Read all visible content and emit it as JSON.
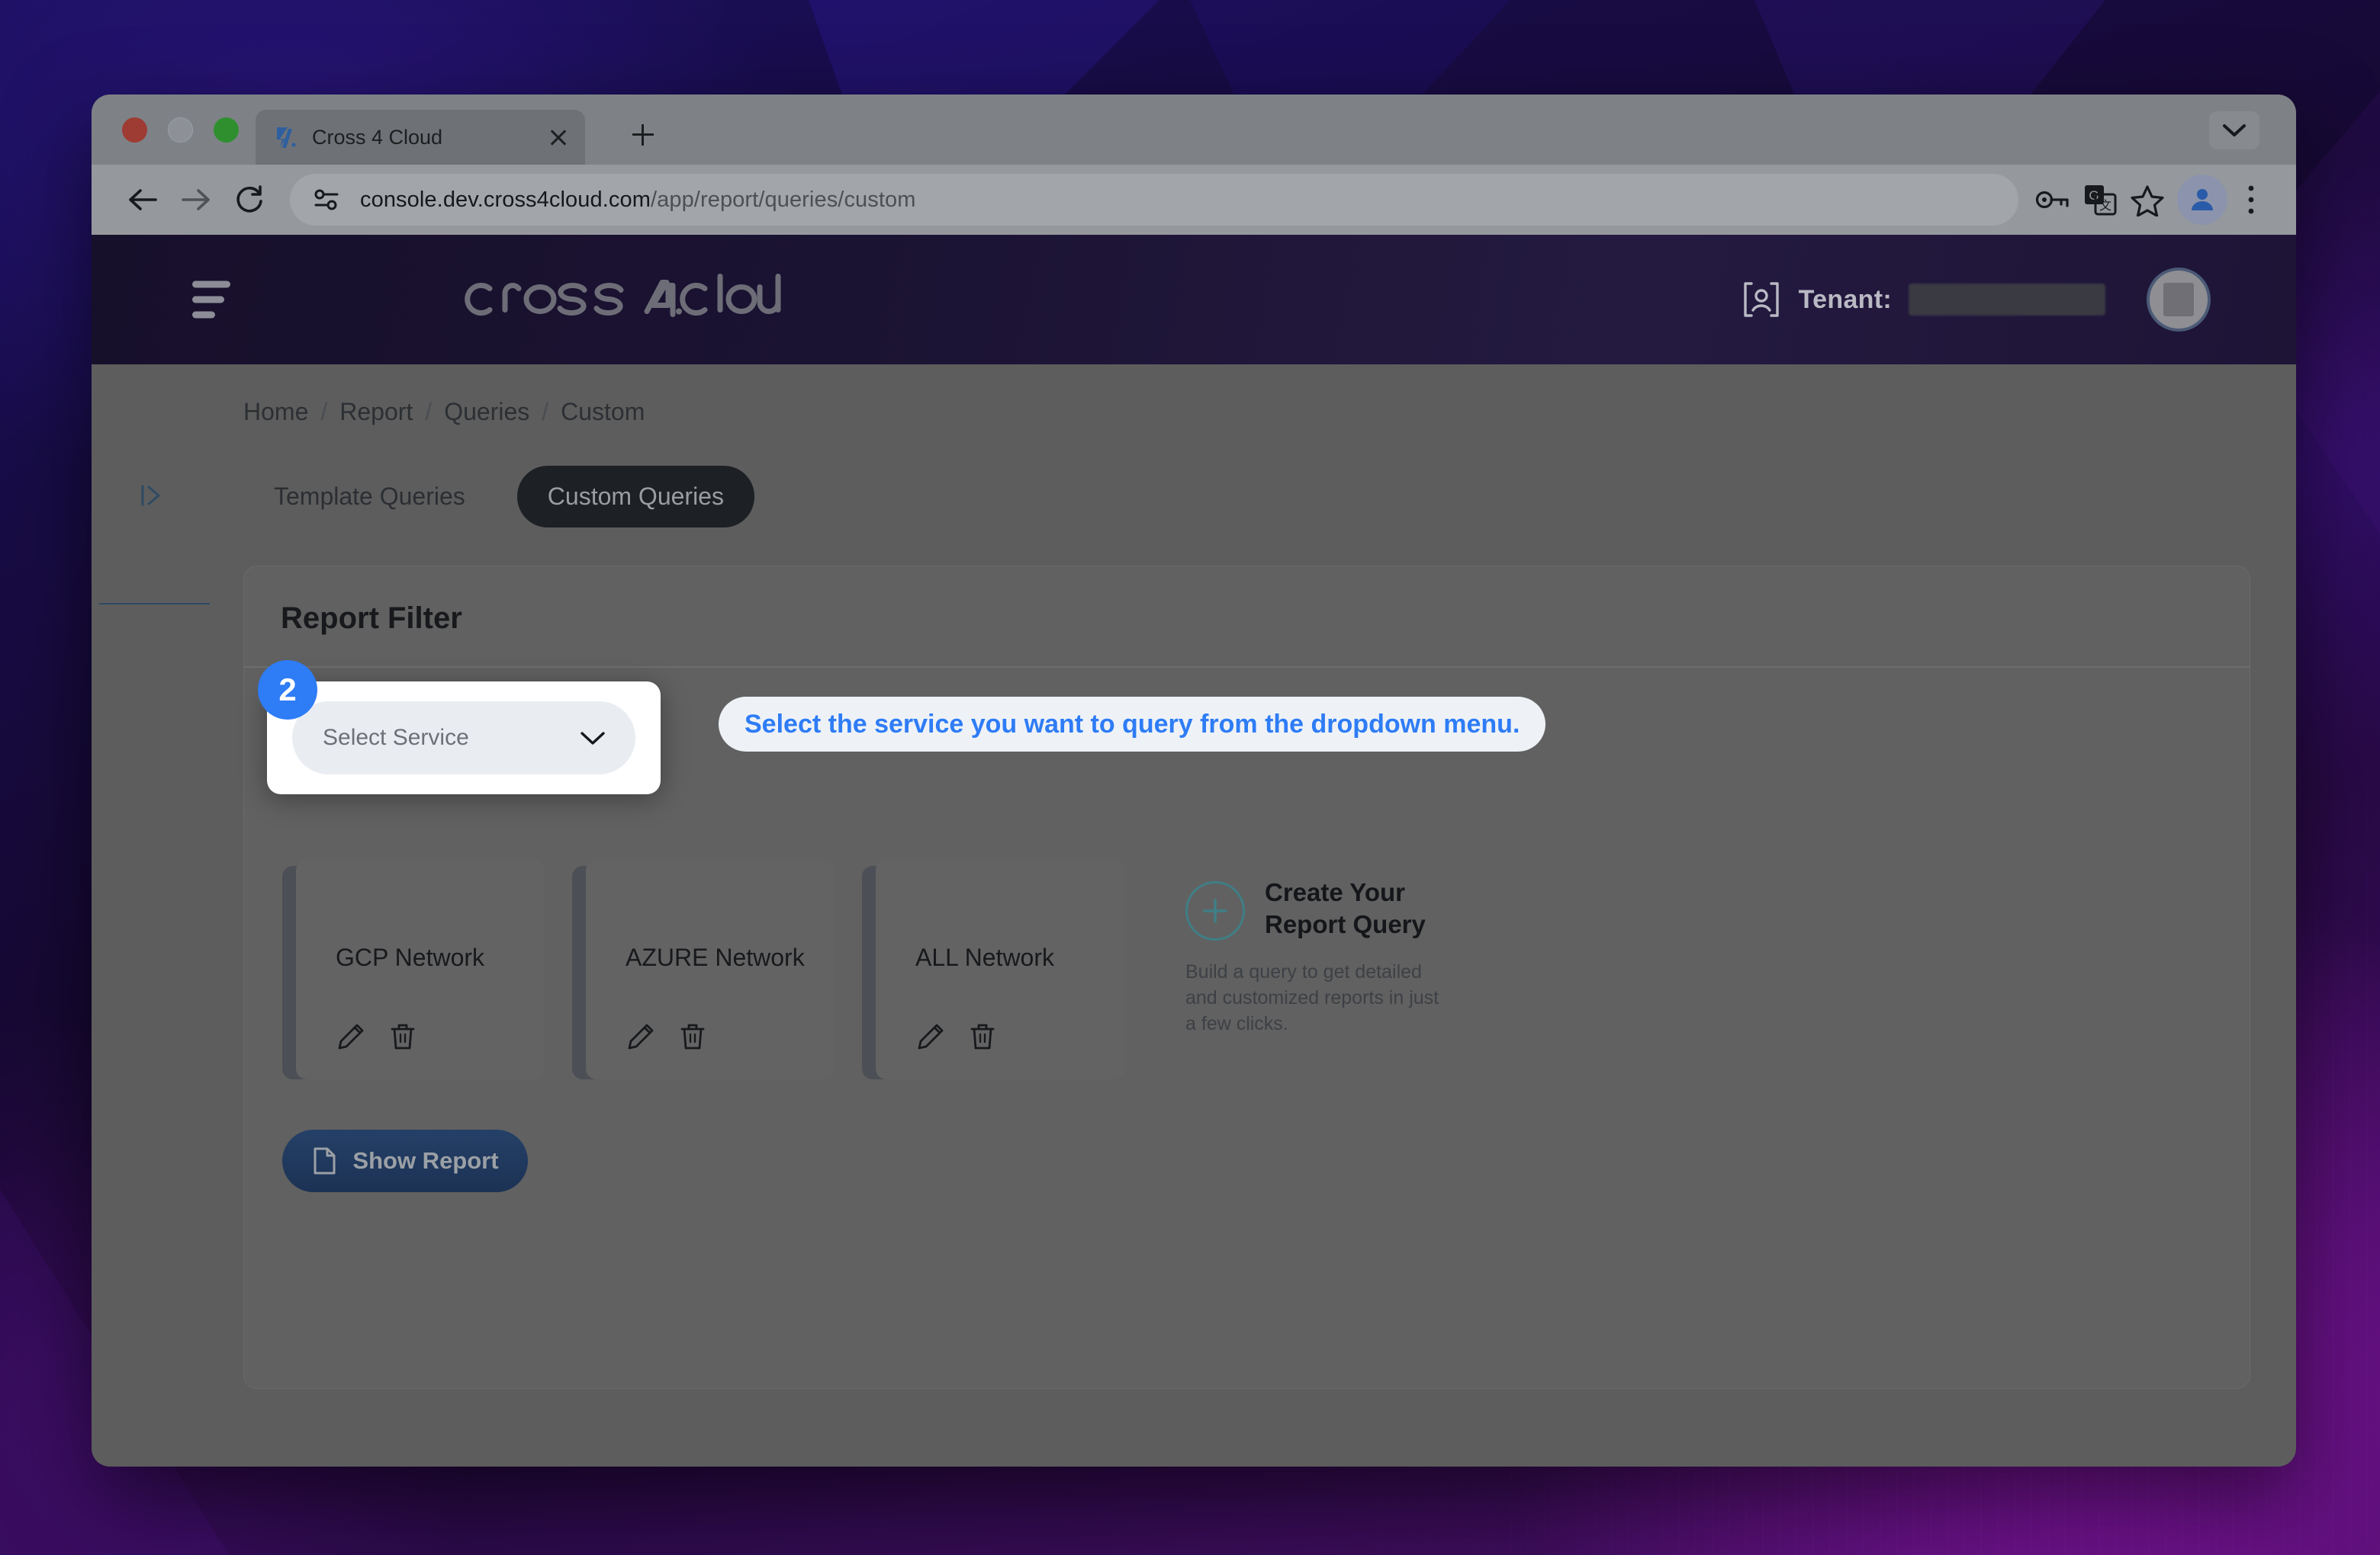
{
  "browser": {
    "tab": {
      "title": "Cross 4 Cloud",
      "favicon_icon": "cross4cloud-logo-icon",
      "close_icon": "close-icon"
    },
    "new_tab_icon": "plus-icon",
    "tabstrip_chevron_icon": "chevron-down-icon",
    "nav": {
      "back_icon": "back-arrow-icon",
      "forward_icon": "forward-arrow-icon",
      "reload_icon": "reload-icon"
    },
    "omnibox": {
      "site_info_icon": "site-settings-icon",
      "url_full": "console.dev.cross4cloud.com/app/report/queries/custom",
      "url_host": "console.dev.cross4cloud.com",
      "url_path": "/app/report/queries/custom"
    },
    "actions": {
      "password_icon": "key-icon",
      "translate_icon": "translate-icon",
      "bookmark_icon": "star-icon",
      "profile_icon": "profile-avatar-icon",
      "menu_icon": "three-dot-menu-icon"
    }
  },
  "app": {
    "header": {
      "menu_icon": "hamburger-menu-icon",
      "brand": "cross4cloud",
      "tenant_label": "Tenant:",
      "tenant_value": "",
      "tenant_icon": "tenant-user-icon",
      "avatar_icon": "user-avatar-icon"
    },
    "sidebar": {
      "expand_icon": "expand-sidebar-icon"
    },
    "breadcrumb": [
      "Home",
      "Report",
      "Queries",
      "Custom"
    ],
    "breadcrumb_separator": "/",
    "tabs": [
      {
        "label": "Template Queries",
        "active": false
      },
      {
        "label": "Custom Queries",
        "active": true
      }
    ],
    "panel": {
      "title": "Report Filter",
      "select_service": {
        "placeholder": "Select Service",
        "value": "",
        "chevron_icon": "chevron-down-icon"
      },
      "step_badge": "2",
      "tooltip": "Select the service you want to query from the dropdown menu.",
      "query_cards": [
        {
          "title": "GCP Network",
          "edit_icon": "pencil-icon",
          "delete_icon": "trash-icon"
        },
        {
          "title": "AZURE Network",
          "edit_icon": "pencil-icon",
          "delete_icon": "trash-icon"
        },
        {
          "title": "ALL Network",
          "edit_icon": "pencil-icon",
          "delete_icon": "trash-icon"
        }
      ],
      "create": {
        "plus_icon": "plus-circle-icon",
        "title_line1": "Create Your",
        "title_line2": "Report Query",
        "description": "Build a query to get detailed and customized reports in just a few clicks."
      },
      "show_report": {
        "label": "Show Report",
        "icon": "document-icon"
      }
    }
  },
  "colors": {
    "accent_blue": "#2e7cf6",
    "tooltip_bg": "#eef2f7",
    "button_blue": "#254067",
    "teal": "#3f7f86",
    "tab_active_bg": "#1d2024"
  }
}
